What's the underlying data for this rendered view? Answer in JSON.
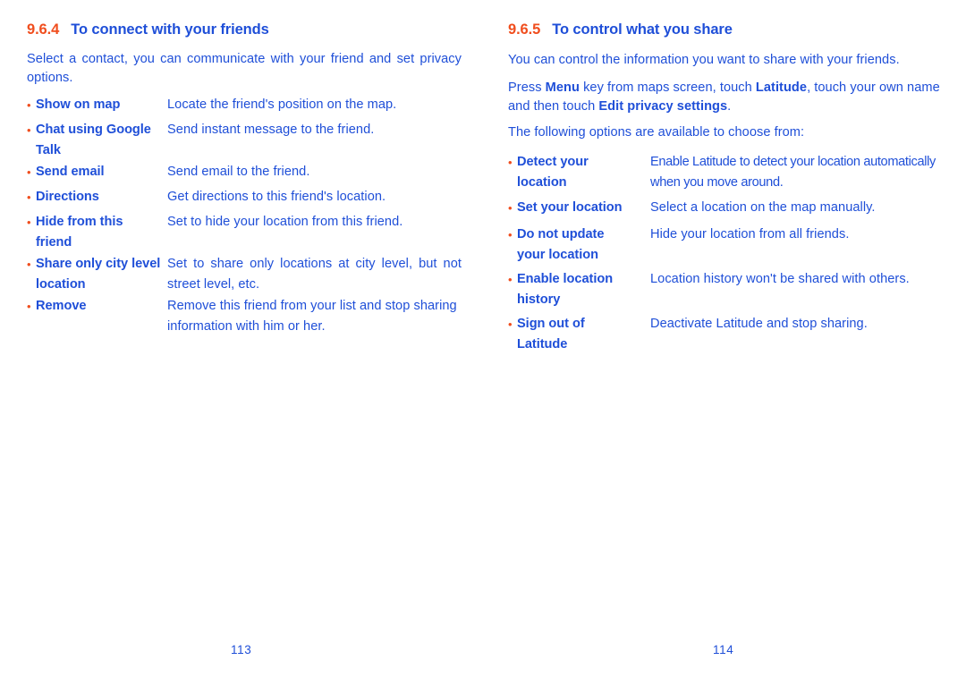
{
  "colors": {
    "text_blue": "#1F4FD8",
    "accent_orange": "#F04E1E"
  },
  "left_page": {
    "page_number": "113",
    "heading": {
      "number": "9.6.4",
      "title": "To connect with your friends"
    },
    "intro": "Select a contact, you can communicate with your friend and set privacy options.",
    "items": [
      {
        "term": "Show on map",
        "desc": "Locate the friend's position on the map."
      },
      {
        "term": "Chat using Google Talk",
        "desc": "Send instant message to the friend."
      },
      {
        "term": "Send email",
        "desc": "Send email to the friend."
      },
      {
        "term": "Directions",
        "desc": "Get directions to this friend's location."
      },
      {
        "term": "Hide from this friend",
        "desc": "Set to hide your location from this friend."
      },
      {
        "term": "Share only city level location",
        "desc": "Set to share only locations at city level, but not street level, etc."
      },
      {
        "term": "Remove",
        "desc": "Remove this friend from your list and stop sharing information with him or her."
      }
    ]
  },
  "right_page": {
    "page_number": "114",
    "heading": {
      "number": "9.6.5",
      "title": "To control what you share"
    },
    "intro": "You can control the information you want to share with your friends.",
    "instruction": {
      "part1": "Press ",
      "bold1": "Menu",
      "part2": " key from maps screen, touch ",
      "bold2": "Latitude",
      "part3": ", touch your own name and then touch ",
      "bold3": "Edit privacy settings",
      "part4": "."
    },
    "options_lead": "The following options are available to choose from:",
    "items": [
      {
        "term": "Detect your location",
        "desc": "Enable Latitude to detect your location automatically when you move around."
      },
      {
        "term": "Set your location",
        "desc": "Select a location on the map manually."
      },
      {
        "term": "Do not update your location",
        "desc": "Hide your location from all friends."
      },
      {
        "term": "Enable location history",
        "desc": "Location history won't be shared with others."
      },
      {
        "term": "Sign out of Latitude",
        "desc": "Deactivate Latitude and stop sharing."
      }
    ]
  },
  "bullet_glyph": "•"
}
